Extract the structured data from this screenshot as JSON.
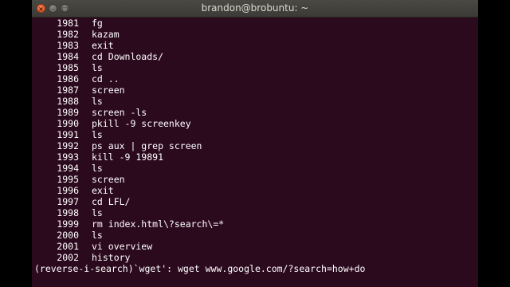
{
  "window": {
    "title": "brandon@brobuntu: ~",
    "close_glyph": "×",
    "min_glyph": "–",
    "max_glyph": "□"
  },
  "terminal": {
    "background": "#2c0a1e",
    "foreground": "#ffffff",
    "history": [
      {
        "num": "1981",
        "cmd": "fg"
      },
      {
        "num": "1982",
        "cmd": "kazam"
      },
      {
        "num": "1983",
        "cmd": "exit"
      },
      {
        "num": "1984",
        "cmd": "cd Downloads/"
      },
      {
        "num": "1985",
        "cmd": "ls"
      },
      {
        "num": "1986",
        "cmd": "cd .."
      },
      {
        "num": "1987",
        "cmd": "screen"
      },
      {
        "num": "1988",
        "cmd": "ls"
      },
      {
        "num": "1989",
        "cmd": "screen -ls"
      },
      {
        "num": "1990",
        "cmd": "pkill -9 screenkey"
      },
      {
        "num": "1991",
        "cmd": "ls"
      },
      {
        "num": "1992",
        "cmd": "ps aux | grep screen"
      },
      {
        "num": "1993",
        "cmd": "kill -9 19891"
      },
      {
        "num": "1994",
        "cmd": "ls"
      },
      {
        "num": "1995",
        "cmd": "screen"
      },
      {
        "num": "1996",
        "cmd": "exit"
      },
      {
        "num": "1997",
        "cmd": "cd LFL/"
      },
      {
        "num": "1998",
        "cmd": "ls"
      },
      {
        "num": "1999",
        "cmd": "rm index.html\\?search\\=*"
      },
      {
        "num": "2000",
        "cmd": "ls"
      },
      {
        "num": "2001",
        "cmd": "vi overview"
      },
      {
        "num": "2002",
        "cmd": "history"
      }
    ],
    "search_line": "(reverse-i-search)`wget': wget www.google.com/?search=how+do"
  }
}
